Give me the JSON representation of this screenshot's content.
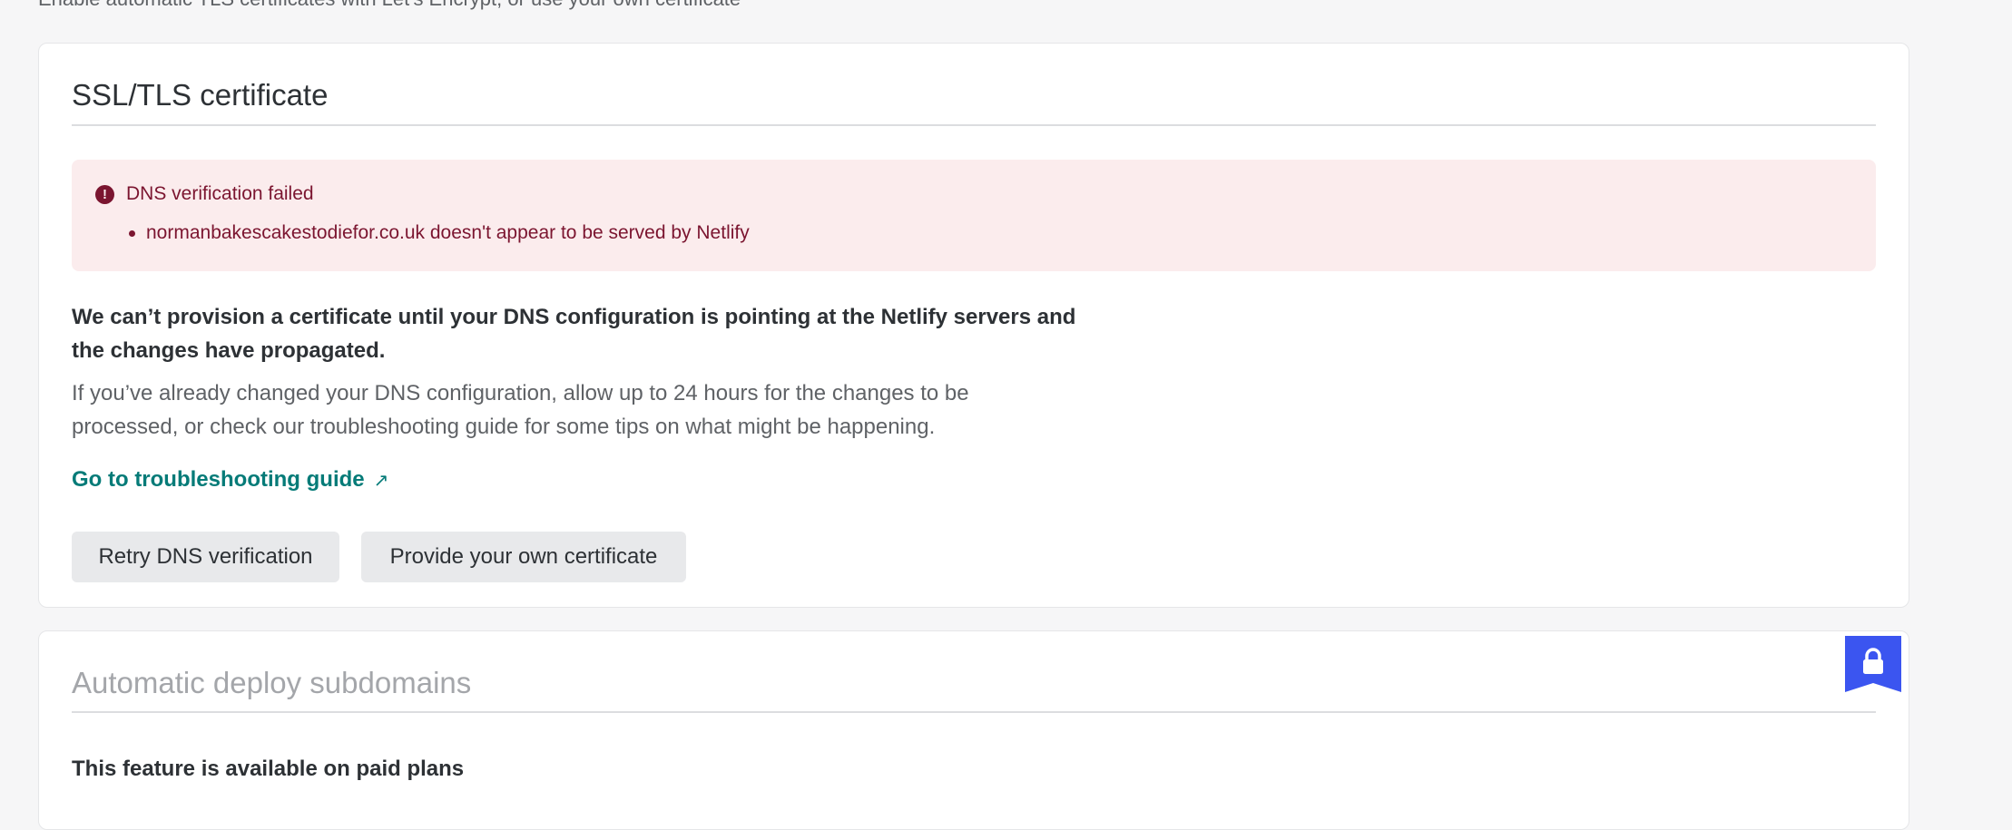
{
  "intro": {
    "text": "Enable automatic TLS certificates with Let's Encrypt, or use your own certificate"
  },
  "ssl_section": {
    "title": "SSL/TLS certificate",
    "alert": {
      "icon": "exclamation-circle-icon",
      "title": "DNS verification failed",
      "items": [
        "normanbakescakestodiefor.co.uk doesn't appear to be served by Netlify"
      ]
    },
    "lead": "We can’t provision a certificate until your DNS configuration is pointing at the Netlify servers and the changes have propagated.",
    "body": "If you’ve already changed your DNS configuration, allow up to 24 hours for the changes to be processed, or check our troubleshooting guide for some tips on what might be happening.",
    "link_label": "Go to troubleshooting guide",
    "link_icon": "↗",
    "buttons": {
      "retry": "Retry DNS verification",
      "own_cert": "Provide your own certificate"
    }
  },
  "subdomains_section": {
    "title": "Automatic deploy subdomains",
    "paid_notice": "This feature is available on paid plans",
    "badge_icon": "lock-icon"
  },
  "colors": {
    "page_bg": "#f6f6f7",
    "alert_bg": "#fbeced",
    "alert_text": "#7b1530",
    "link": "#057b78",
    "badge": "#3b55f0"
  }
}
